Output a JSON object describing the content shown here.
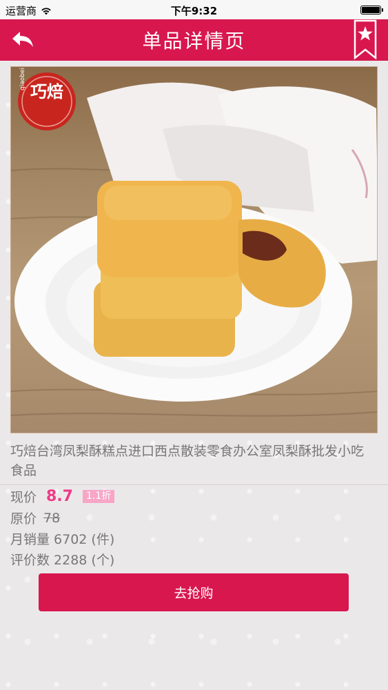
{
  "status_bar": {
    "carrier": "运营商",
    "time": "下午9:32"
  },
  "nav": {
    "title": "单品详情页",
    "back_icon": "back-arrow-icon",
    "favorite_icon": "star-bookmark-icon"
  },
  "product": {
    "brand_logo_text": "巧焙",
    "brand_logo_subtext": "qiaobei",
    "title": "巧焙台湾凤梨酥糕点进口西点散装零食办公室凤梨酥批发小吃食品",
    "current_price_label": "现价",
    "current_price": "8.7",
    "discount": "1.1折",
    "original_price_label": "原价",
    "original_price": "78",
    "monthly_sales_label": "月销量",
    "monthly_sales": "6702 (件)",
    "review_count_label": "评价数",
    "review_count": "2288 (个)"
  },
  "actions": {
    "buy_label": "去抢购"
  },
  "colors": {
    "brand": "#d8174f",
    "price": "#ee3a87",
    "discount_badge": "#f7a6c6"
  }
}
